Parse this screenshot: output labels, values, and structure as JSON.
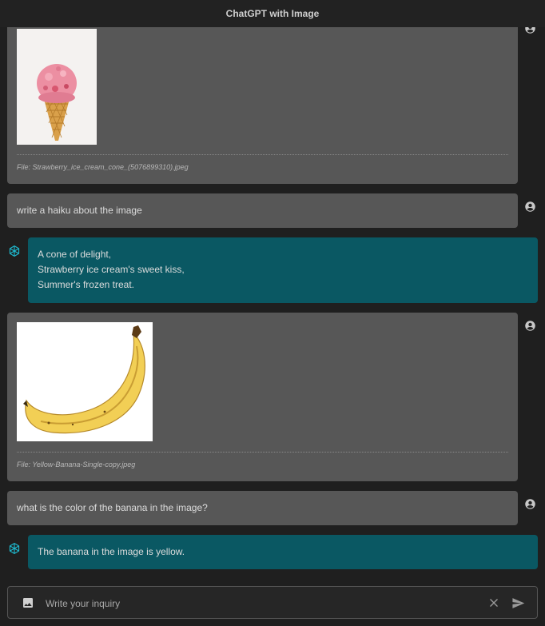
{
  "header": {
    "title": "ChatGPT with Image"
  },
  "messages": [
    {
      "role": "user",
      "type": "image",
      "alt": "Strawberry ice cream cone",
      "file_label": "File: Strawberry_ice_cream_cone_(5076899310).jpeg"
    },
    {
      "role": "user",
      "type": "text",
      "text": "write a haiku about the image"
    },
    {
      "role": "assistant",
      "type": "text",
      "lines": [
        "A cone of delight,",
        "Strawberry ice cream's sweet kiss,",
        "Summer's frozen treat."
      ]
    },
    {
      "role": "user",
      "type": "image",
      "alt": "Yellow banana",
      "file_label": "File: Yellow-Banana-Single-copy.jpeg"
    },
    {
      "role": "user",
      "type": "text",
      "text": "what is the color of the banana in the image?"
    },
    {
      "role": "assistant",
      "type": "text",
      "text": "The banana in the image is yellow."
    }
  ],
  "composer": {
    "placeholder": "Write your inquiry",
    "value": ""
  },
  "icons": {
    "user": "user-circle-icon",
    "assistant": "openai-logo-icon",
    "attach": "image-icon",
    "clear": "close-icon",
    "send": "send-icon"
  },
  "colors": {
    "user_bubble": "#575757",
    "assistant_bubble": "#0a5863",
    "background": "#1f1f1f",
    "header": "#222222",
    "accent_logo": "#1fb8cd"
  }
}
